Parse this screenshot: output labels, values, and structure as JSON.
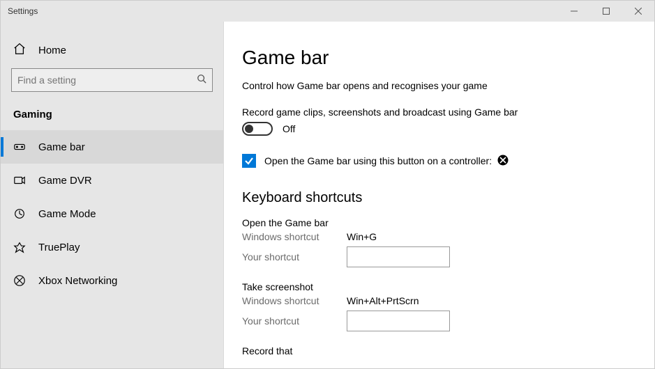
{
  "titlebar": {
    "title": "Settings"
  },
  "sidebar": {
    "home_label": "Home",
    "search_placeholder": "Find a setting",
    "category_label": "Gaming",
    "items": [
      {
        "label": "Game bar"
      },
      {
        "label": "Game DVR"
      },
      {
        "label": "Game Mode"
      },
      {
        "label": "TruePlay"
      },
      {
        "label": "Xbox Networking"
      }
    ]
  },
  "main": {
    "title": "Game bar",
    "description": "Control how Game bar opens and recognises your game",
    "toggle_setting_label": "Record game clips, screenshots and broadcast using Game bar",
    "toggle_state": "Off",
    "checkbox_label": "Open the Game bar using this button on a controller:",
    "section_title": "Keyboard shortcuts",
    "shortcuts": [
      {
        "name": "Open the Game bar",
        "windows_label": "Windows shortcut",
        "windows_value": "Win+G",
        "your_label": "Your shortcut",
        "your_value": ""
      },
      {
        "name": "Take screenshot",
        "windows_label": "Windows shortcut",
        "windows_value": "Win+Alt+PrtScrn",
        "your_label": "Your shortcut",
        "your_value": ""
      }
    ],
    "truncated_label": "Record that"
  }
}
